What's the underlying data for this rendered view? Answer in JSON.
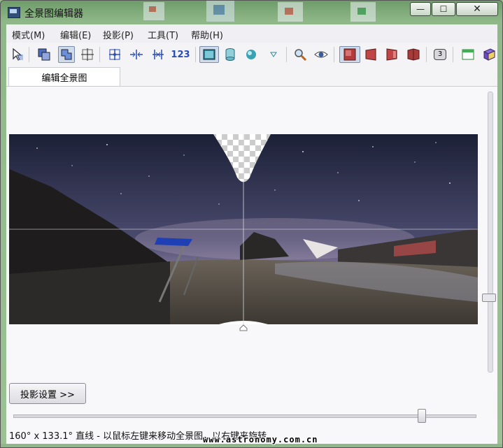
{
  "window": {
    "title": "全景图编辑器",
    "min_glyph": "—",
    "max_glyph": "☐",
    "close_glyph": "✕"
  },
  "menu": [
    "模式(M)",
    "编辑(E)",
    "投影(P)",
    "工具(T)",
    "帮助(H)"
  ],
  "toolbar": {
    "number_label": "123",
    "view_badge": "3",
    "buttons": [
      {
        "icon": "pointer-icon",
        "active": false
      },
      {
        "icon": "fit-window-icon",
        "active": false
      },
      {
        "icon": "multi-window-icon",
        "active": true
      },
      {
        "icon": "crosshair-icon",
        "active": false
      },
      {
        "icon": "move-center-icon",
        "active": false
      },
      {
        "icon": "horizontal-align-icon",
        "active": false
      },
      {
        "icon": "vertical-align-icon",
        "active": false
      },
      {
        "icon": "number-icon",
        "active": false
      },
      {
        "icon": "rectilinear-icon",
        "active": true
      },
      {
        "icon": "cylinder-icon",
        "active": false
      },
      {
        "icon": "sphere-icon",
        "active": false
      },
      {
        "icon": "dropdown-arrow-icon",
        "active": false
      },
      {
        "icon": "magnifier-icon",
        "active": false
      },
      {
        "icon": "eye-icon",
        "active": false
      },
      {
        "icon": "plane-icon",
        "active": true
      },
      {
        "icon": "skew-left-icon",
        "active": false
      },
      {
        "icon": "skew-right-icon",
        "active": false
      },
      {
        "icon": "fold-icon",
        "active": false
      },
      {
        "icon": "view-3-icon",
        "active": false
      },
      {
        "icon": "window-icon",
        "active": false
      },
      {
        "icon": "book-icon",
        "active": false
      }
    ]
  },
  "tab": {
    "label": "编辑全景图"
  },
  "projection_button": "投影设置 >>",
  "status": "160° x 133.1° 直线 - 以鼠标左键来移动全景图，以右键来旋转",
  "watermark": "www.astronomy.com.cn",
  "sliders": {
    "horizontal_value": 0.89,
    "vertical_value": 0.77
  },
  "colors": {
    "accent_red": "#b33a3a",
    "accent_blue": "#2a4db3",
    "active_bg": "#cfdbea"
  }
}
